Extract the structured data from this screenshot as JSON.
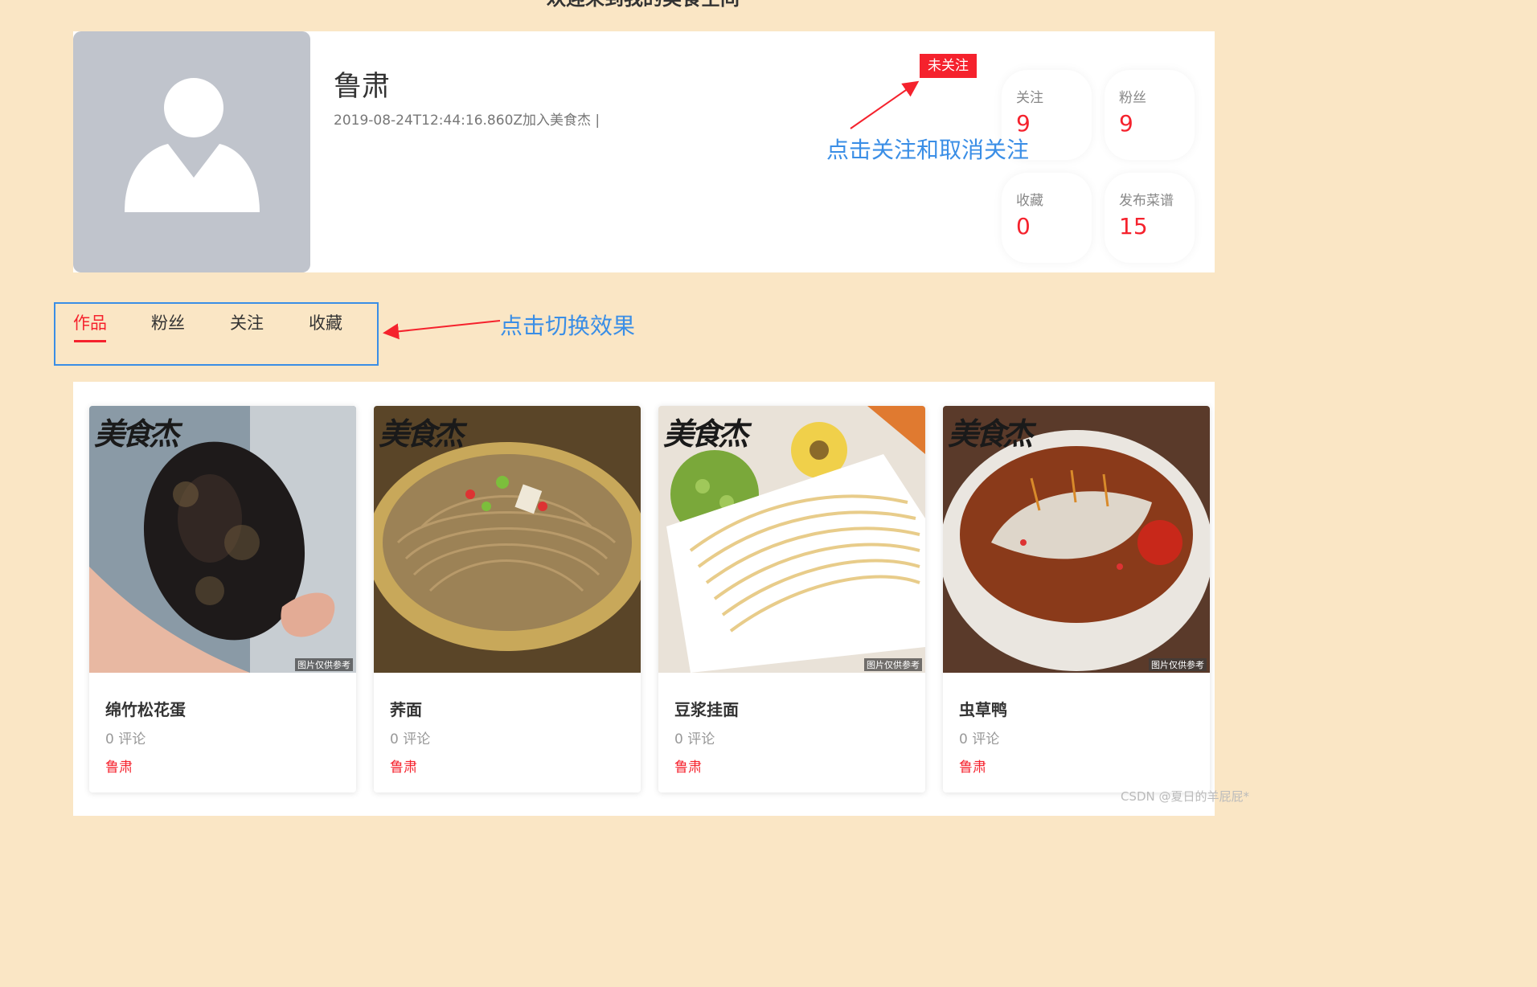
{
  "page": {
    "heading": "欢迎来到我的美食空间"
  },
  "profile": {
    "name": "鲁肃",
    "join_info": "2019-08-24T12:44:16.860Z加入美食杰 |",
    "follow_status": "未关注",
    "stats": [
      {
        "label": "关注",
        "value": "9"
      },
      {
        "label": "粉丝",
        "value": "9"
      },
      {
        "label": "收藏",
        "value": "0"
      },
      {
        "label": "发布菜谱",
        "value": "15"
      }
    ]
  },
  "annotations": {
    "follow_hint": "点击关注和取消关注",
    "tab_hint": "点击切换效果",
    "color": "#3a8ee6"
  },
  "tabs": [
    {
      "label": "作品",
      "active": true
    },
    {
      "label": "粉丝",
      "active": false
    },
    {
      "label": "关注",
      "active": false
    },
    {
      "label": "收藏",
      "active": false
    }
  ],
  "recipes": [
    {
      "title": "绵竹松花蛋",
      "comments": "0 评论",
      "author": "鲁肃",
      "image": "preserved-egg"
    },
    {
      "title": "荞面",
      "comments": "0 评论",
      "author": "鲁肃",
      "image": "buckwheat-noodles"
    },
    {
      "title": "豆浆挂面",
      "comments": "0 评论",
      "author": "鲁肃",
      "image": "soy-milk-noodles"
    },
    {
      "title": "虫草鸭",
      "comments": "0 评论",
      "author": "鲁肃",
      "image": "cordyceps-duck"
    }
  ],
  "image_text": {
    "watermark": "美食杰",
    "reference": "图片仅供参考"
  },
  "footer": {
    "credit": "CSDN @夏日的羊屁屁*"
  },
  "colors": {
    "background": "#fae6c5",
    "accent": "#f5222d",
    "avatar_bg": "#c0c4cc"
  }
}
